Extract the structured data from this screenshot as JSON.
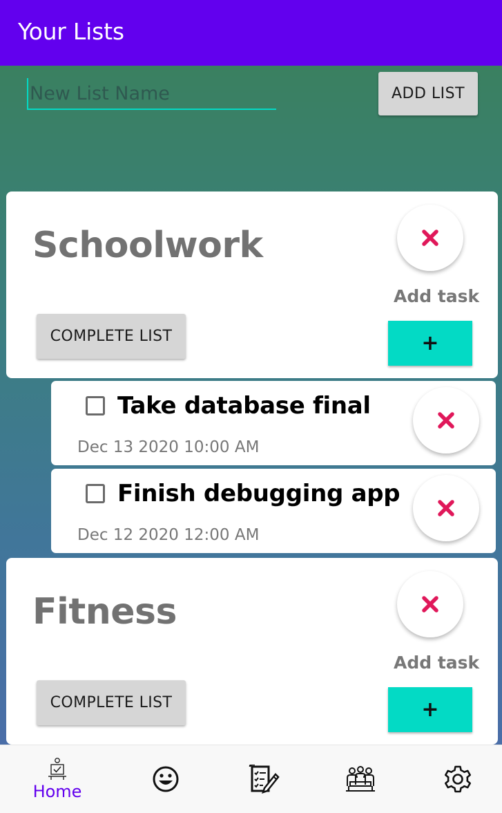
{
  "app_bar": {
    "title": "Your Lists"
  },
  "new_list": {
    "placeholder": "New List Name",
    "value": "",
    "button_label": "ADD LIST"
  },
  "lists": [
    {
      "name": "Schoolwork",
      "add_task_label": "Add task",
      "add_task_button": "+",
      "complete_label": "COMPLETE LIST",
      "tasks": [
        {
          "name": "Take database final",
          "date": "Dec 13 2020 10:00 AM",
          "checked": false
        },
        {
          "name": "Finish debugging app",
          "date": "Dec 12 2020 12:00 AM",
          "checked": false
        }
      ]
    },
    {
      "name": "Fitness",
      "add_task_label": "Add task",
      "add_task_button": "+",
      "complete_label": "COMPLETE LIST",
      "tasks": []
    }
  ],
  "bottom_nav": {
    "items": [
      {
        "label": "Home",
        "icon": "home-icon",
        "active": true
      },
      {
        "label": "",
        "icon": "smiley-icon",
        "active": false
      },
      {
        "label": "",
        "icon": "notes-edit-icon",
        "active": false
      },
      {
        "label": "",
        "icon": "group-icon",
        "active": false
      },
      {
        "label": "",
        "icon": "gear-icon",
        "active": false
      }
    ]
  },
  "colors": {
    "primary": "#6200ee",
    "accent": "#03dac5",
    "delete": "#e0185a"
  }
}
